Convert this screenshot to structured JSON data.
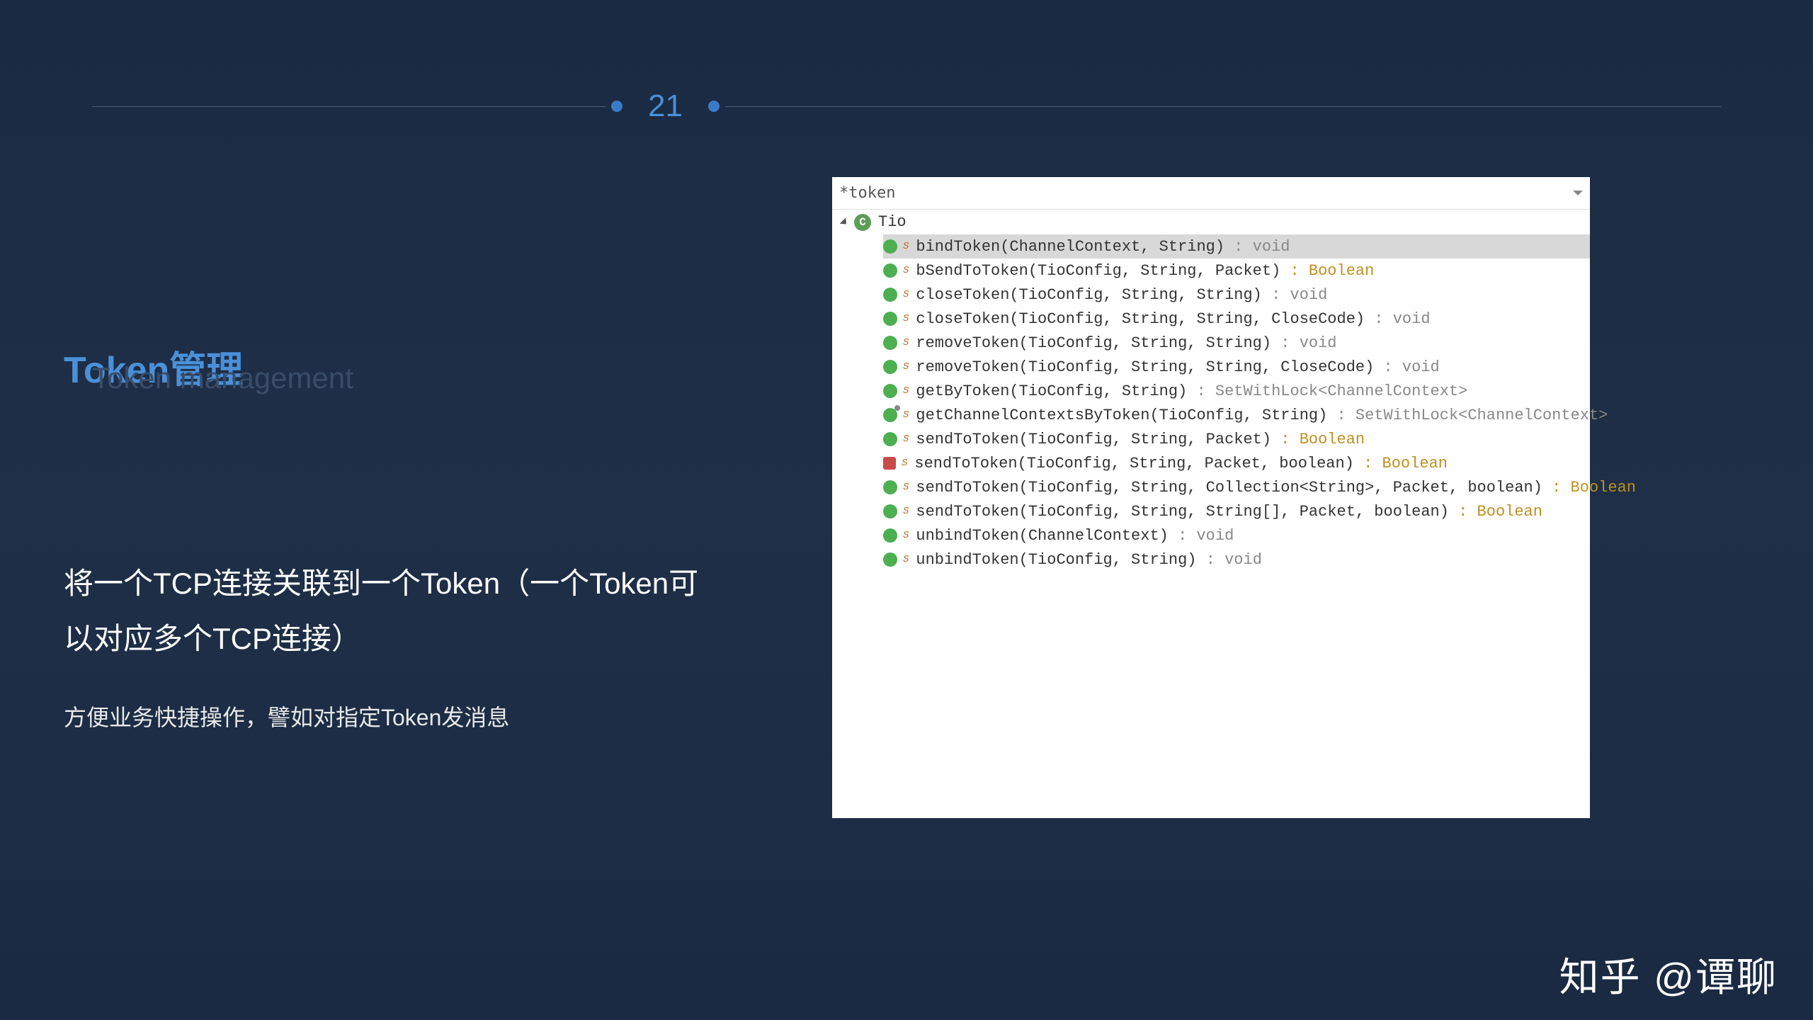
{
  "page": {
    "number": "21"
  },
  "title": {
    "main": "Token管理",
    "sub": "Token management"
  },
  "description": {
    "line1": "将一个TCP连接关联到一个Token（一个Token可以对应多个TCP连接）",
    "line2": "方便业务快捷操作，譬如对指定Token发消息"
  },
  "ide": {
    "search": "*token",
    "class_name": "Tio",
    "methods": [
      {
        "sig": "bindToken(ChannelContext, String)",
        "ret": ": void",
        "ret_class": "ret-type",
        "icon": "pub",
        "selected": true
      },
      {
        "sig": "bSendToToken(TioConfig, String, Packet)",
        "ret": ": Boolean",
        "ret_class": "ret-bool",
        "icon": "pub"
      },
      {
        "sig": "closeToken(TioConfig, String, String)",
        "ret": ": void",
        "ret_class": "ret-type",
        "icon": "pub"
      },
      {
        "sig": "closeToken(TioConfig, String, String, CloseCode)",
        "ret": ": void",
        "ret_class": "ret-type",
        "icon": "pub"
      },
      {
        "sig": "removeToken(TioConfig, String, String)",
        "ret": ": void",
        "ret_class": "ret-type",
        "icon": "pub"
      },
      {
        "sig": "removeToken(TioConfig, String, String, CloseCode)",
        "ret": ": void",
        "ret_class": "ret-type",
        "icon": "pub"
      },
      {
        "sig": "getByToken(TioConfig, String)",
        "ret": ": SetWithLock<ChannelContext>",
        "ret_class": "ret-generic",
        "icon": "pub"
      },
      {
        "sig": "getChannelContextsByToken(TioConfig, String)",
        "ret": ": SetWithLock<ChannelContext>",
        "ret_class": "ret-generic",
        "icon": "default"
      },
      {
        "sig": "sendToToken(TioConfig, String, Packet)",
        "ret": ": Boolean",
        "ret_class": "ret-bool",
        "icon": "pub"
      },
      {
        "sig": "sendToToken(TioConfig, String, Packet, boolean)",
        "ret": ": Boolean",
        "ret_class": "ret-bool",
        "icon": "red"
      },
      {
        "sig": "sendToToken(TioConfig, String, Collection<String>, Packet, boolean)",
        "ret": ": Boolean",
        "ret_class": "ret-bool",
        "icon": "pub"
      },
      {
        "sig": "sendToToken(TioConfig, String, String[], Packet, boolean)",
        "ret": ": Boolean",
        "ret_class": "ret-bool",
        "icon": "pub"
      },
      {
        "sig": "unbindToken(ChannelContext)",
        "ret": ": void",
        "ret_class": "ret-type",
        "icon": "pub"
      },
      {
        "sig": "unbindToken(TioConfig, String)",
        "ret": ": void",
        "ret_class": "ret-type",
        "icon": "pub"
      }
    ]
  },
  "watermark": "知乎 @谭聊"
}
